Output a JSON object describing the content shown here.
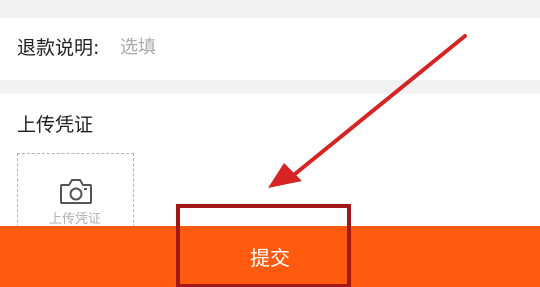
{
  "refund_note": {
    "label": "退款说明:",
    "placeholder": "选填"
  },
  "upload": {
    "title": "上传凭证",
    "box_label": "上传凭证",
    "icon": "camera-icon"
  },
  "submit": {
    "label": "提交"
  },
  "annotation": {
    "color": "#d62424",
    "icon": "arrow-pointer-icon"
  },
  "colors": {
    "accent": "#ff5a0e",
    "background": "#f2f2f2",
    "placeholder": "#aaaaaa"
  }
}
